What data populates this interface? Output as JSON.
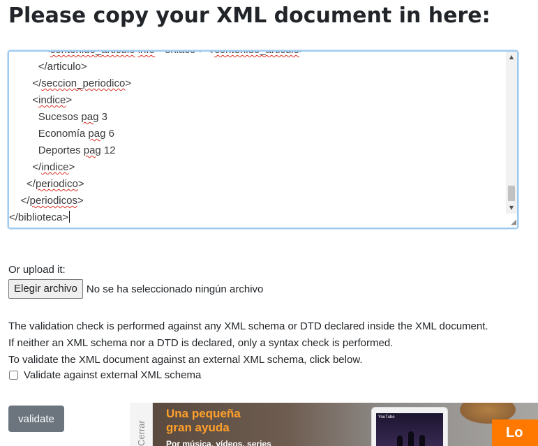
{
  "page": {
    "title": "Please copy your XML document in here:"
  },
  "editor": {
    "lines": [
      {
        "indent": "            ",
        "parts": [
          {
            "t": "<",
            "s": false
          },
          {
            "t": "contenido_articulo",
            "s": true
          },
          {
            "t": " ",
            "s": false
          },
          {
            "t": "info",
            "s": true
          },
          {
            "t": "=\"enlace\"></",
            "s": false
          },
          {
            "t": "contenido_articulo",
            "s": true
          },
          {
            "t": ">",
            "s": false
          }
        ]
      },
      {
        "indent": "          ",
        "parts": [
          {
            "t": "</articulo>",
            "s": false
          }
        ]
      },
      {
        "indent": "        ",
        "parts": [
          {
            "t": "</",
            "s": false
          },
          {
            "t": "seccion_periodico",
            "s": true
          },
          {
            "t": ">",
            "s": false
          }
        ]
      },
      {
        "indent": "        ",
        "parts": [
          {
            "t": "<",
            "s": false
          },
          {
            "t": "indice",
            "s": true
          },
          {
            "t": ">",
            "s": false
          }
        ]
      },
      {
        "indent": "          ",
        "parts": [
          {
            "t": "Sucesos ",
            "s": false
          },
          {
            "t": "pag",
            "s": true
          },
          {
            "t": " 3",
            "s": false
          }
        ]
      },
      {
        "indent": "          ",
        "parts": [
          {
            "t": "Economía ",
            "s": false
          },
          {
            "t": "pag",
            "s": true
          },
          {
            "t": " 6",
            "s": false
          }
        ]
      },
      {
        "indent": "          ",
        "parts": [
          {
            "t": "Deportes ",
            "s": false
          },
          {
            "t": "pag",
            "s": true
          },
          {
            "t": " 12",
            "s": false
          }
        ]
      },
      {
        "indent": "        ",
        "parts": [
          {
            "t": "</",
            "s": false
          },
          {
            "t": "indice",
            "s": true
          },
          {
            "t": ">",
            "s": false
          }
        ]
      },
      {
        "indent": "      ",
        "parts": [
          {
            "t": "</",
            "s": false
          },
          {
            "t": "periodico",
            "s": true
          },
          {
            "t": ">",
            "s": false
          }
        ]
      },
      {
        "indent": "    ",
        "parts": [
          {
            "t": "</",
            "s": false
          },
          {
            "t": "periodicos",
            "s": true
          },
          {
            "t": ">",
            "s": false
          }
        ]
      },
      {
        "indent": "",
        "parts": [
          {
            "t": "</biblioteca>",
            "s": false
          }
        ]
      }
    ],
    "scroll_up_icon": "triangle-up",
    "scroll_down_icon": "triangle-down",
    "resize_icon": "resize-grip"
  },
  "upload": {
    "label": "Or upload it:",
    "button_label": "Elegir archivo",
    "status": "No se ha seleccionado ningún archivo"
  },
  "info": {
    "line1": "The validation check is performed against any XML schema or DTD declared inside the XML document.",
    "line2": "If neither an XML schema nor a DTD is declared, only a syntax check is performed.",
    "line3": "To validate the XML document against an external XML schema, click below."
  },
  "external_schema": {
    "label": "Validate against external XML schema",
    "checked": false
  },
  "validate_button": {
    "label": "validate",
    "color": "#6c757d"
  },
  "ad": {
    "close_label": "Cerrar",
    "headline_1": "Una pequeña",
    "headline_2": "gran ayuda",
    "subline": "Por música, vídeos, series",
    "tablet_brand": "YouTube",
    "cta": "Lo",
    "accent": "#ff7900"
  }
}
